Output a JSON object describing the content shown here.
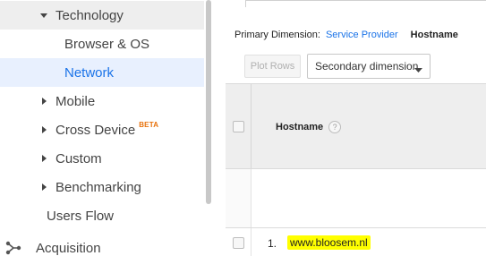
{
  "sidebar": {
    "items": [
      {
        "label": "Technology",
        "caret": "caret-down"
      },
      {
        "label": "Browser & OS"
      },
      {
        "label": "Network"
      },
      {
        "label": "Mobile",
        "caret": "caret-right"
      },
      {
        "label": "Cross Device",
        "caret": "caret-right",
        "badge": "BETA"
      },
      {
        "label": "Custom",
        "caret": "caret-right"
      },
      {
        "label": "Benchmarking",
        "caret": "caret-right"
      },
      {
        "label": "Users Flow"
      },
      {
        "label": "Acquisition",
        "icon": "acquisition-icon"
      }
    ]
  },
  "toolbar": {
    "primary_dimension_label": "Primary Dimension:",
    "primary_dimension_option": "Service Provider",
    "primary_dimension_current": "Hostname",
    "plot_rows_label": "Plot Rows",
    "secondary_dimension_label": "Secondary dimension"
  },
  "table": {
    "column_header": "Hostname",
    "help_glyph": "?",
    "rows": [
      {
        "index": "1.",
        "hostname": "www.bloosem.nl"
      }
    ]
  },
  "colors": {
    "accent": "#1a73e8",
    "beta": "#e8710a",
    "highlight": "#ffff00"
  }
}
